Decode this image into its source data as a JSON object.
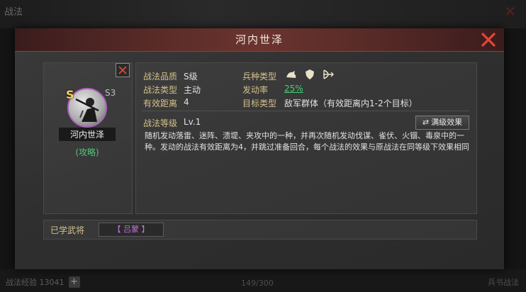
{
  "background": {
    "top_label": "战法",
    "bottom_left_text": "战法经验 13041",
    "bottom_mid_text": "149/300",
    "bottom_right_text": "兵书战法"
  },
  "dialog": {
    "title": "河内世泽"
  },
  "hero": {
    "grade": "S",
    "star_level": "S3",
    "name": "河内世泽",
    "strategy_link": "(攻略)"
  },
  "details": {
    "quality_label": "战法品质",
    "quality_value": "S级",
    "type_label": "战法类型",
    "type_value": "主动",
    "range_label": "有效距离",
    "range_value": "4",
    "unit_type_label": "兵种类型",
    "unit_icons": [
      "cavalry-icon",
      "shield-icon",
      "bow-icon"
    ],
    "trigger_label": "发动率",
    "trigger_value": "25%",
    "target_label": "目标类型",
    "target_value": "敌军群体（有效距离内1-2个目标）",
    "level_label": "战法等级",
    "level_value": "Lv.1",
    "full_effect_label": "满级效果",
    "description": "随机发动落雷、迷阵、溃堤、夹攻中的一种，并再次随机发动伐谋、雀伏、火锢、毒泉中的一种。发动的战法有效距离为4，并跳过准备回合，每个战法的效果与原战法在同等级下效果相同"
  },
  "learned": {
    "label": "已学武将",
    "general": "【 吕蒙 】"
  },
  "colors": {
    "accent_red": "#e0473a",
    "label_gold": "#d4c08a",
    "green": "#49d17a",
    "purple": "#c070d8"
  }
}
